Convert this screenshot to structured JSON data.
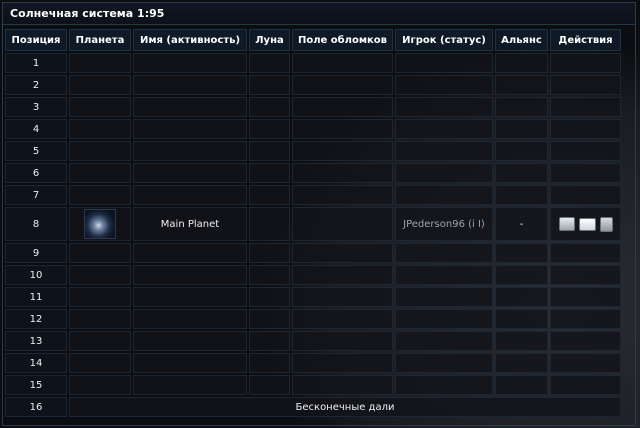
{
  "title": "Солнечная система 1:95",
  "columns": [
    "Позиция",
    "Планета",
    "Имя (активность)",
    "Луна",
    "Поле обломков",
    "Игрок (статус)",
    "Альянс",
    "Действия"
  ],
  "rows": [
    {
      "pos": "1"
    },
    {
      "pos": "2"
    },
    {
      "pos": "3"
    },
    {
      "pos": "4"
    },
    {
      "pos": "5"
    },
    {
      "pos": "6"
    },
    {
      "pos": "7"
    },
    {
      "pos": "8",
      "planet_name": "Main Planet",
      "player": "JPederson96 (i I)",
      "alliance": "-"
    },
    {
      "pos": "9"
    },
    {
      "pos": "10"
    },
    {
      "pos": "11"
    },
    {
      "pos": "12"
    },
    {
      "pos": "13"
    },
    {
      "pos": "14"
    },
    {
      "pos": "15"
    }
  ],
  "deep_space": {
    "pos": "16",
    "label": "Бесконечные дали"
  },
  "action_icons": [
    "spy-icon",
    "message-icon",
    "buddy-request-icon"
  ]
}
